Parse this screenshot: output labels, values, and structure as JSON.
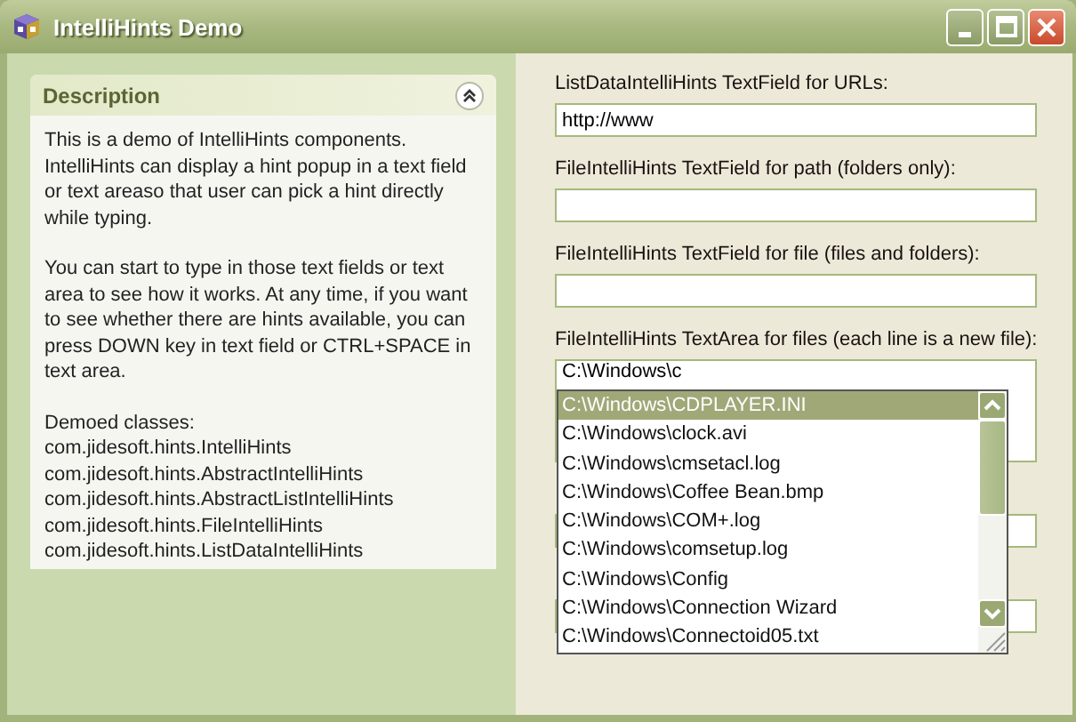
{
  "window": {
    "title": "IntelliHints Demo"
  },
  "description": {
    "title": "Description",
    "expanded": true,
    "paragraphs": [
      "This is a demo of IntelliHints components. IntelliHints can display a hint popup in a text field or text areaso that user can pick a hint directly while typing.",
      "You can start to type in those text fields or text area to see how it works. At any time, if you want to see whether there are hints available, you can press DOWN key in text field or CTRL+SPACE in text area."
    ],
    "classes_heading": "Demoed classes:",
    "classes": [
      "com.jidesoft.hints.IntelliHints",
      "com.jidesoft.hints.AbstractIntelliHints",
      "com.jidesoft.hints.AbstractListIntelliHints",
      "com.jidesoft.hints.FileIntelliHints",
      "com.jidesoft.hints.ListDataIntelliHints"
    ]
  },
  "fields": [
    {
      "kind": "field",
      "label": "ListDataIntelliHints TextField for URLs:",
      "value": "http://www"
    },
    {
      "kind": "field",
      "label": "FileIntelliHints TextField for path (folders only):"
    },
    {
      "kind": "field",
      "label": "FileIntelliHints TextField for file (files and folders):"
    },
    {
      "kind": "area",
      "label": "FileIntelliHints TextArea for files (each line is a new file):",
      "value": "C:\\Windows\\c"
    },
    {
      "kind": "field"
    },
    {
      "kind": "field"
    }
  ],
  "hint_popup": {
    "items": [
      {
        "text": "C:\\Windows\\CDPLAYER.INI",
        "selected": true
      },
      {
        "text": "C:\\Windows\\clock.avi",
        "selected": false
      },
      {
        "text": "C:\\Windows\\cmsetacl.log",
        "selected": false
      },
      {
        "text": "C:\\Windows\\Coffee Bean.bmp",
        "selected": false
      },
      {
        "text": "C:\\Windows\\COM+.log",
        "selected": false
      },
      {
        "text": "C:\\Windows\\comsetup.log",
        "selected": false
      },
      {
        "text": "C:\\Windows\\Config",
        "selected": false
      },
      {
        "text": "C:\\Windows\\Connection Wizard",
        "selected": false
      },
      {
        "text": "C:\\Windows\\Connectoid05.txt",
        "selected": false
      }
    ]
  }
}
